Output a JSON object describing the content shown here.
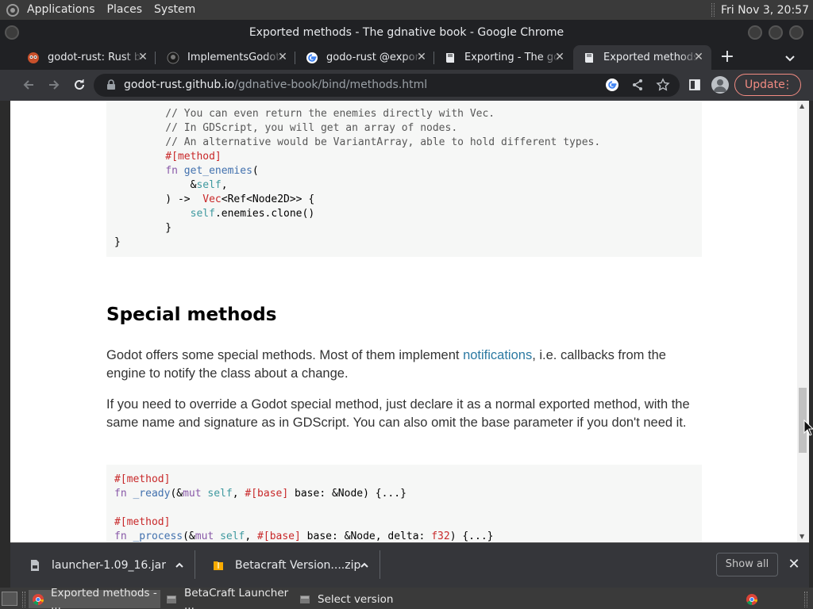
{
  "top_panel": {
    "menus": [
      "Applications",
      "Places",
      "System"
    ],
    "clock": "Fri Nov 3, 20:57"
  },
  "window": {
    "title": "Exported methods - The gdnative book - Google Chrome"
  },
  "tabs": [
    {
      "label": "godot-rust: Rust bindings",
      "favicon": "godot-rust-icon"
    },
    {
      "label": "ImplementsGodotBase",
      "favicon": "github-icon"
    },
    {
      "label": "godo-rust @export",
      "favicon": "google-icon"
    },
    {
      "label": "Exporting - The gdnative book",
      "favicon": "book-icon"
    },
    {
      "label": "Exported methods",
      "favicon": "book-icon"
    }
  ],
  "toolbar": {
    "url_host": "godot-rust.github.io",
    "url_path": "/gdnative-book/bind/methods.html",
    "update_label": "Update"
  },
  "page": {
    "code_top": [
      "    // You can even return the enemies directly with Vec.",
      "    // In GDScript, you will get an array of nodes.",
      "    // An alternative would be VariantArray, able to hold different types.",
      "    #[method]",
      "    fn get_enemies(",
      "        &self,",
      "    ) ->  Vec<Ref<Node2D>> {",
      "        self.enemies.clone()",
      "    }",
      "}"
    ],
    "heading": "Special methods",
    "para1_before": "Godot offers some special methods. Most of them implement ",
    "para1_link": "notifications",
    "para1_after": ", i.e. callbacks from the engine to notify the class about a change.",
    "para2": "If you need to override a Godot special method, just declare it as a normal exported method, with the same name and signature as in GDScript. You can also omit the base parameter if you don't need it.",
    "code_bottom": [
      "#[method]",
      "fn _ready(&mut self, #[base] base: &Node) {...}",
      "",
      "#[method]",
      "fn _process(&mut self, #[base] base: &Node, delta: f32) {...}"
    ]
  },
  "downloads": {
    "items": [
      {
        "name": "launcher-1.09_16.jar"
      },
      {
        "name": "Betacraft Version....zip"
      }
    ],
    "show_all_label": "Show all"
  },
  "taskbar": {
    "items": [
      {
        "label": "Exported methods - ..."
      },
      {
        "label": "BetaCraft Launcher ..."
      },
      {
        "label": "Select version"
      }
    ]
  }
}
